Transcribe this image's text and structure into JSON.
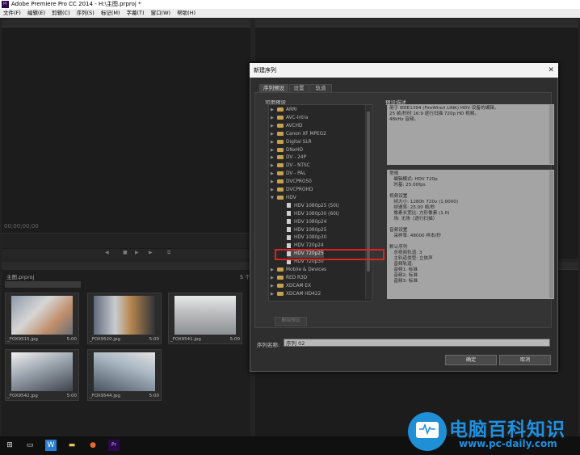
{
  "window": {
    "title": "Adobe Premiere Pro CC 2014 - H:\\主图.prproj *"
  },
  "menu": [
    "文件(F)",
    "编辑(E)",
    "剪辑(C)",
    "序列(S)",
    "标记(M)",
    "字幕(T)",
    "窗口(W)",
    "帮助(H)"
  ],
  "source_monitor": {
    "timecode": "00;00;00;00"
  },
  "project": {
    "name": "主图.prproj",
    "count": "5 个",
    "items": [
      {
        "name": "_FOX9515.jpg",
        "duration": "5:00"
      },
      {
        "name": "_FOX9520.jpg",
        "duration": "5:00"
      },
      {
        "name": "_FOX9541.jpg",
        "duration": "5:00"
      },
      {
        "name": "_FOX9542.jpg",
        "duration": "5:00"
      },
      {
        "name": "_FOX9544.jpg",
        "duration": "5:00"
      }
    ]
  },
  "dialog": {
    "title": "新建序列",
    "tabs": [
      "序列预设",
      "设置",
      "轨道"
    ],
    "available_presets_label": "可用预设",
    "preset_desc_label": "预设描述",
    "tree": [
      {
        "label": "ARRI",
        "type": "folder",
        "expanded": false
      },
      {
        "label": "AVC-Intra",
        "type": "folder",
        "expanded": false
      },
      {
        "label": "AVCHD",
        "type": "folder",
        "expanded": false
      },
      {
        "label": "Canon XF MPEG2",
        "type": "folder",
        "expanded": false
      },
      {
        "label": "Digital SLR",
        "type": "folder",
        "expanded": false
      },
      {
        "label": "DNxHD",
        "type": "folder",
        "expanded": false
      },
      {
        "label": "DV - 24P",
        "type": "folder",
        "expanded": false
      },
      {
        "label": "DV - NTSC",
        "type": "folder",
        "expanded": false
      },
      {
        "label": "DV - PAL",
        "type": "folder",
        "expanded": false
      },
      {
        "label": "DVCPRO50",
        "type": "folder",
        "expanded": false
      },
      {
        "label": "DVCPROHD",
        "type": "folder",
        "expanded": false
      },
      {
        "label": "HDV",
        "type": "folder",
        "expanded": true
      },
      {
        "label": "HDV 1080p25 (50i)",
        "type": "file"
      },
      {
        "label": "HDV 1080p30 (60i)",
        "type": "file"
      },
      {
        "label": "HDV 1080p24",
        "type": "file"
      },
      {
        "label": "HDV 1080p25",
        "type": "file"
      },
      {
        "label": "HDV 1080p30",
        "type": "file"
      },
      {
        "label": "HDV 720p24",
        "type": "file"
      },
      {
        "label": "HDV 720p25",
        "type": "file",
        "selected": true
      },
      {
        "label": "HDV 720p30",
        "type": "file"
      },
      {
        "label": "Mobile & Devices",
        "type": "folder",
        "expanded": false
      },
      {
        "label": "RED R3D",
        "type": "folder",
        "expanded": false
      },
      {
        "label": "XDCAM EX",
        "type": "folder",
        "expanded": false
      },
      {
        "label": "XDCAM HD422",
        "type": "folder",
        "expanded": false
      }
    ],
    "desc_top": [
      "用于 IEEE1394 (FireWire/i.LINK) HDV 设备的编辑。",
      "25 帧/秒时 16:9 逐行扫描 720p HD 视频。",
      "48kHz 音频。"
    ],
    "desc_bottom": "常规\n   编辑模式: HDV 720p\n   时基: 25.00fps\n\n视频设置\n   帧大小: 1280h 720v (1.0000)\n   帧速率: 25.00 帧/秒\n   像素长宽比: 方形像素 (1.0)\n   场: 无场（逐行扫描）\n\n音频设置\n   采样率: 48000 样本/秒\n\n默认序列\n   总视频轨道: 3\n   主轨道类型: 立体声\n   音频轨道:\n   音频1: 标准\n   音频2: 标准\n   音频3: 标准",
    "delete_preset": "删除预设",
    "seq_name_label": "序列名称:",
    "seq_name_value": "序列 02",
    "ok": "确定",
    "cancel": "取消"
  },
  "watermark": {
    "title": "电脑百科知识",
    "sub": "www.pc-daily.com",
    "color": "#1e90e0"
  },
  "colors": {
    "highlight": "#dd2222",
    "dialog_bg": "#2e2e2e"
  }
}
